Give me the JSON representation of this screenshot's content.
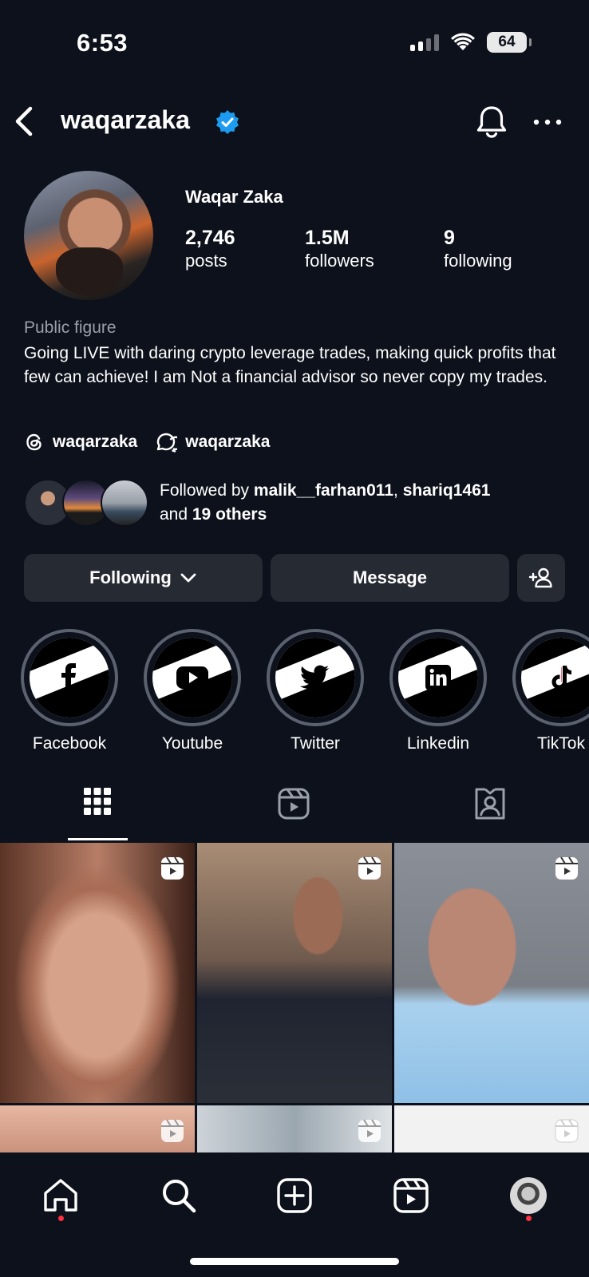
{
  "status_bar": {
    "time": "6:53",
    "battery": "64"
  },
  "header": {
    "username": "waqarzaka"
  },
  "profile": {
    "display_name": "Waqar Zaka",
    "stats": [
      {
        "value": "2,746",
        "label": "posts"
      },
      {
        "value": "1.5M",
        "label": "followers"
      },
      {
        "value": "9",
        "label": "following"
      }
    ],
    "category": "Public figure",
    "bio": "Going LIVE with daring crypto leverage trades, making quick profits that few can achieve! I am Not a financial advisor so never copy my trades.",
    "links": [
      {
        "icon": "threads-icon",
        "label": "waqarzaka"
      },
      {
        "icon": "messenger-icon",
        "label": "waqarzaka"
      }
    ],
    "followed_by": {
      "prefix": "Followed by ",
      "user1": "malik__farhan011",
      "separator": ", ",
      "user2": "shariq1461",
      "and": "and ",
      "others": "19 others"
    }
  },
  "actions": {
    "following_label": "Following",
    "message_label": "Message"
  },
  "highlights": [
    {
      "label": "Facebook",
      "icon": "facebook-icon"
    },
    {
      "label": "Youtube",
      "icon": "youtube-icon"
    },
    {
      "label": "Twitter",
      "icon": "twitter-icon"
    },
    {
      "label": "Linkedin",
      "icon": "linkedin-icon"
    },
    {
      "label": "TikTok",
      "icon": "tiktok-icon"
    }
  ],
  "tabs": [
    {
      "icon": "grid-icon",
      "active": true
    },
    {
      "icon": "reels-icon",
      "active": false
    },
    {
      "icon": "tagged-icon",
      "active": false
    }
  ],
  "colors": {
    "background": "#0c111b",
    "button": "#262a33",
    "verified": "#1d9bf0",
    "notification_dot": "#ff3040"
  }
}
